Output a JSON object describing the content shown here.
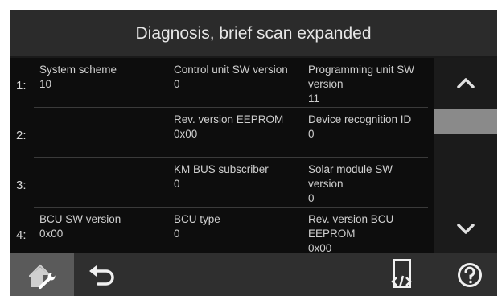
{
  "header": {
    "title": "Diagnosis, brief scan expanded"
  },
  "rows": [
    {
      "number": "1:",
      "cells": [
        {
          "label": "System scheme",
          "value": "10"
        },
        {
          "label": "Control unit SW version",
          "value": "0"
        },
        {
          "label": "Programming unit SW version",
          "value": "11"
        }
      ]
    },
    {
      "number": "2:",
      "cells": [
        {
          "label": "",
          "value": ""
        },
        {
          "label": "Rev. version EEPROM",
          "value": "0x00"
        },
        {
          "label": "Device recognition ID",
          "value": "0"
        }
      ]
    },
    {
      "number": "3:",
      "cells": [
        {
          "label": "",
          "value": ""
        },
        {
          "label": "KM BUS subscriber",
          "value": "0"
        },
        {
          "label": "Solar module SW version",
          "value": "0"
        }
      ]
    },
    {
      "number": "4:",
      "cells": [
        {
          "label": "BCU SW version",
          "value": "0x00"
        },
        {
          "label": "BCU type",
          "value": "0"
        },
        {
          "label": "Rev. version BCU EEPROM",
          "value": "0x00"
        }
      ]
    }
  ],
  "scroll": {
    "position_fraction": 0.2
  },
  "icons": {
    "home": "home-wrench-icon",
    "back": "back-arrow-icon",
    "code": "document-code-icon",
    "help": "help-question-icon",
    "up": "chevron-up-icon",
    "down": "chevron-down-icon"
  },
  "colors": {
    "background": "#111111",
    "text": "#cfcfcf",
    "scroll_thumb": "#8a8a8a",
    "active_button": "#5a5a5a"
  }
}
